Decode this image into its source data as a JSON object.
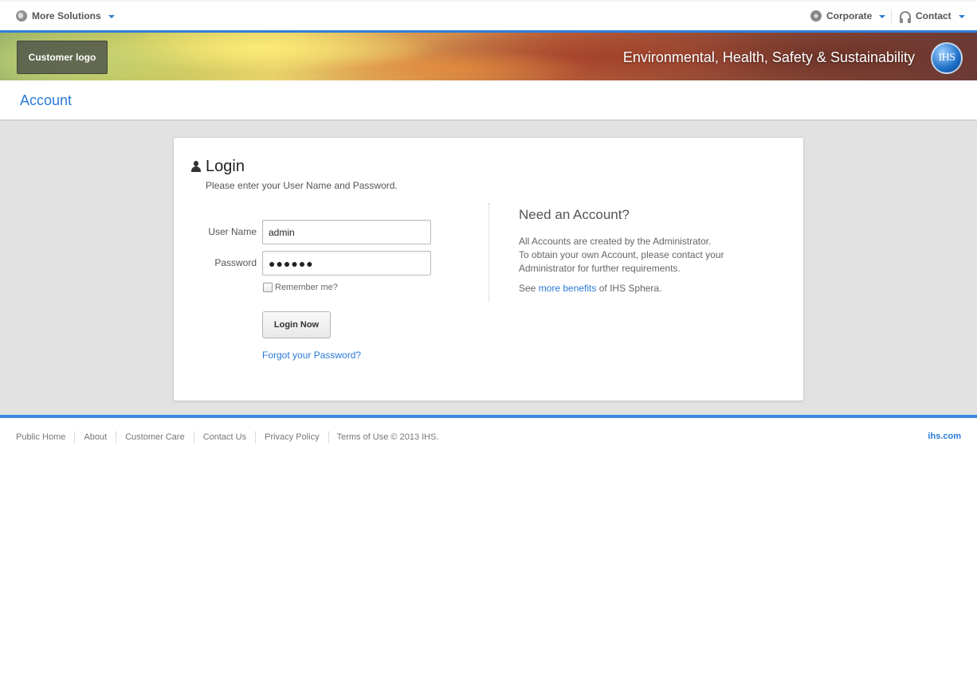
{
  "topbar": {
    "more_solutions": "More Solutions",
    "corporate": "Corporate",
    "contact": "Contact"
  },
  "banner": {
    "customer_logo": "Customer logo",
    "title": "Environmental, Health, Safety & Sustainability",
    "ihs_logo_text": "IHS"
  },
  "account": {
    "title": "Account"
  },
  "login": {
    "title": "Login",
    "subtitle": "Please enter your User Name and Password.",
    "username_label": "User Name",
    "username_value": "admin",
    "password_label": "Password",
    "password_value": "●●●●●●",
    "remember_label": "Remember me?",
    "submit_label": "Login Now",
    "forgot_label": "Forgot your Password?"
  },
  "need_account": {
    "title": "Need an Account?",
    "line1": "All Accounts are created by the Administrator.",
    "line2": "To obtain your own Account, please contact your Administrator for further requirements.",
    "benefits_prefix": "See ",
    "benefits_link": "more benefits",
    "benefits_suffix": " of IHS Sphera."
  },
  "footer": {
    "links": [
      "Public Home",
      "About",
      "Customer Care",
      "Contact Us",
      "Privacy Policy"
    ],
    "terms": "Terms of Use © 2013 IHS.",
    "right_link": "ihs.com"
  },
  "colors": {
    "accent_blue": "#2a7ad6",
    "banner_border": "#2f7fd8",
    "main_bg": "#e2e2e2"
  }
}
